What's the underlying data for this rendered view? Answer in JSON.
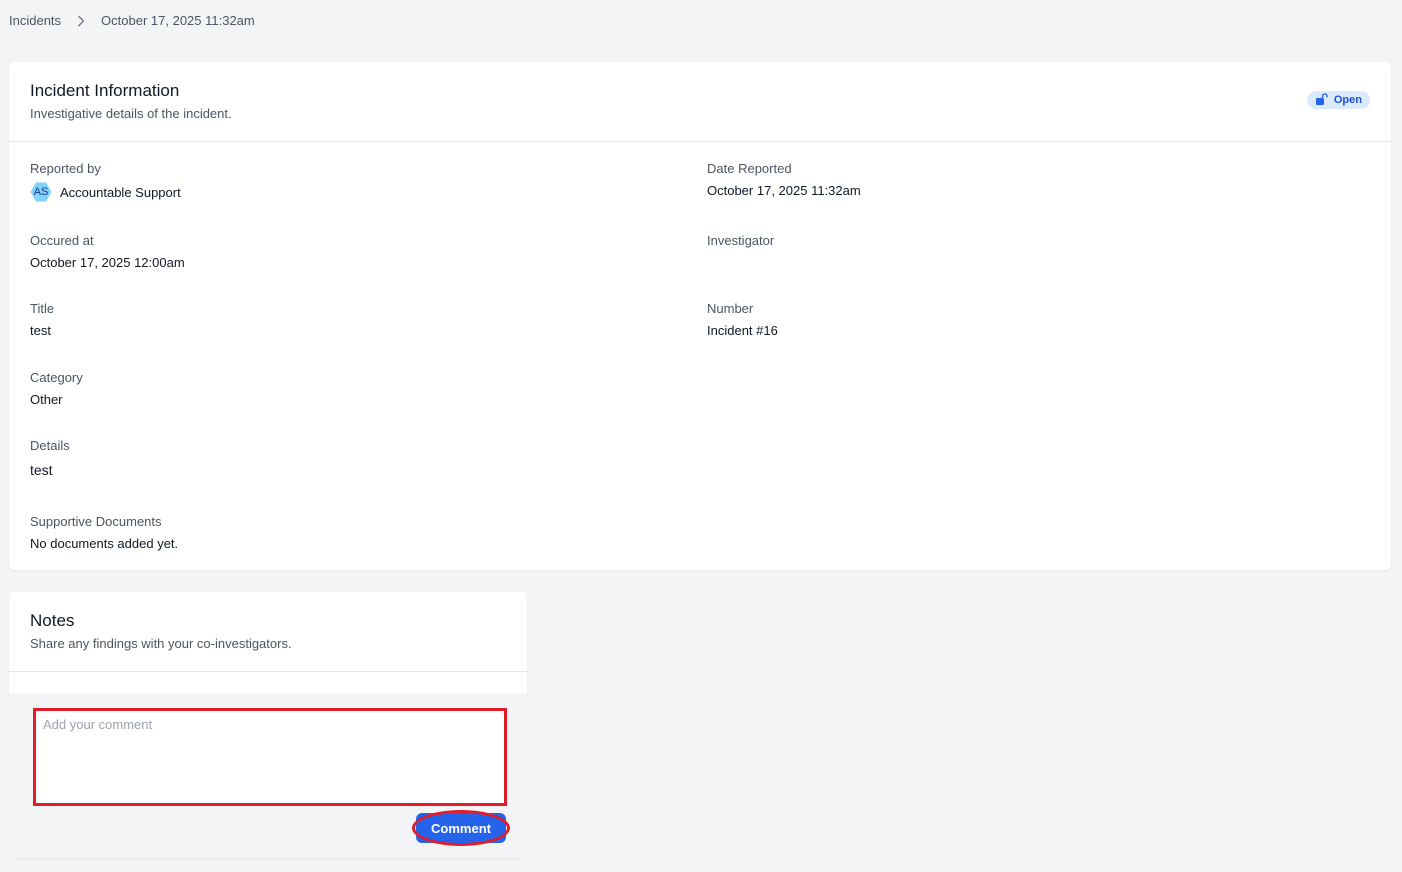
{
  "breadcrumb": {
    "root": "Incidents",
    "current": "October 17, 2025 11:32am"
  },
  "incident": {
    "title": "Incident Information",
    "subtitle": "Investigative details of the incident.",
    "status": "Open",
    "status_icon": "unlock-icon",
    "fields": {
      "reported_by_label": "Reported by",
      "reporter_initials": "AS",
      "reporter_name": "Accountable Support",
      "date_reported_label": "Date Reported",
      "date_reported": "October 17, 2025 11:32am",
      "occured_at_label": "Occured at",
      "occured_at": "October 17, 2025 12:00am",
      "investigator_label": "Investigator",
      "investigator": "",
      "title_label": "Title",
      "title": "test",
      "number_label": "Number",
      "number": "Incident #16",
      "category_label": "Category",
      "category": "Other",
      "details_label": "Details",
      "details": "test",
      "documents_label": "Supportive Documents",
      "documents": "No documents added yet."
    }
  },
  "notes": {
    "title": "Notes",
    "subtitle": "Share any findings with your co-investigators.",
    "comment_placeholder": "Add your comment",
    "comment_button": "Comment"
  },
  "colors": {
    "accent": "#2563eb",
    "badge_bg": "#dbeafe",
    "highlight": "#e11d2a",
    "avatar": "#7dd3fc"
  }
}
